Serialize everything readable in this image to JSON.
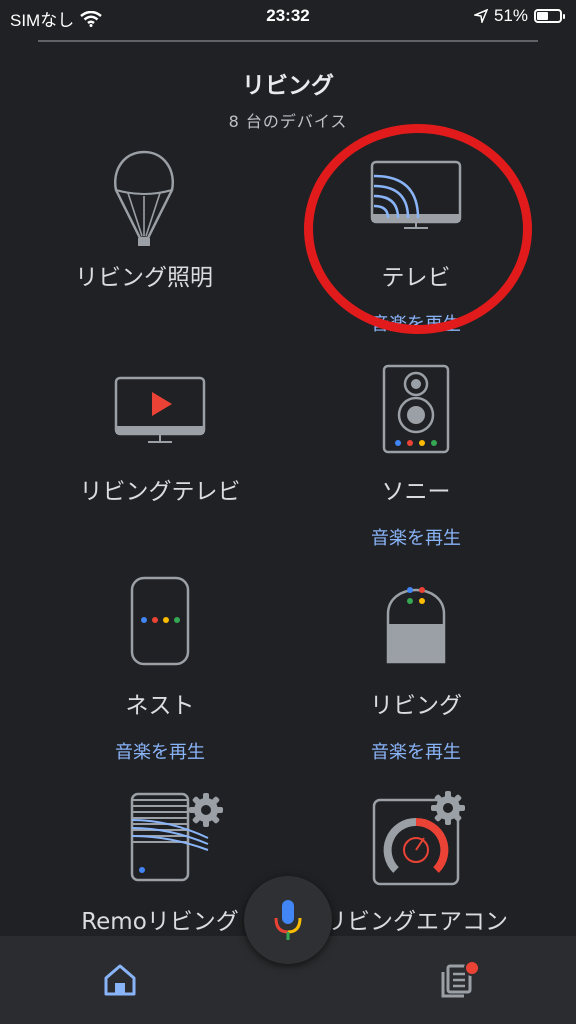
{
  "status_bar": {
    "carrier": "SIMなし",
    "time": "23:32",
    "battery": "51%",
    "battery_level": 0.51
  },
  "room": {
    "title": "リビング",
    "device_count": "8 台のデバイス"
  },
  "devices": [
    {
      "label": "リビング照明",
      "action": "",
      "icon": "lightbulb-icon"
    },
    {
      "label": "テレビ",
      "action": "音楽を再生",
      "icon": "cast-tv-icon"
    },
    {
      "label": "リビングテレビ",
      "action": "",
      "icon": "tv-play-icon"
    },
    {
      "label": "ソニー",
      "action": "音楽を再生",
      "icon": "speaker-icon"
    },
    {
      "label": "ネスト",
      "action": "音楽を再生",
      "icon": "nest-speaker-icon"
    },
    {
      "label": "リビング",
      "action": "音楽を再生",
      "icon": "google-home-icon"
    },
    {
      "label": "Remoリビング",
      "action": "",
      "icon": "remo-device-icon"
    },
    {
      "label": "リビングエアコン",
      "action": "",
      "icon": "aircon-thermostat-icon"
    }
  ],
  "colors": {
    "accent": "#8ab4f8",
    "highlight": "#e11b1b",
    "background": "#202124"
  }
}
